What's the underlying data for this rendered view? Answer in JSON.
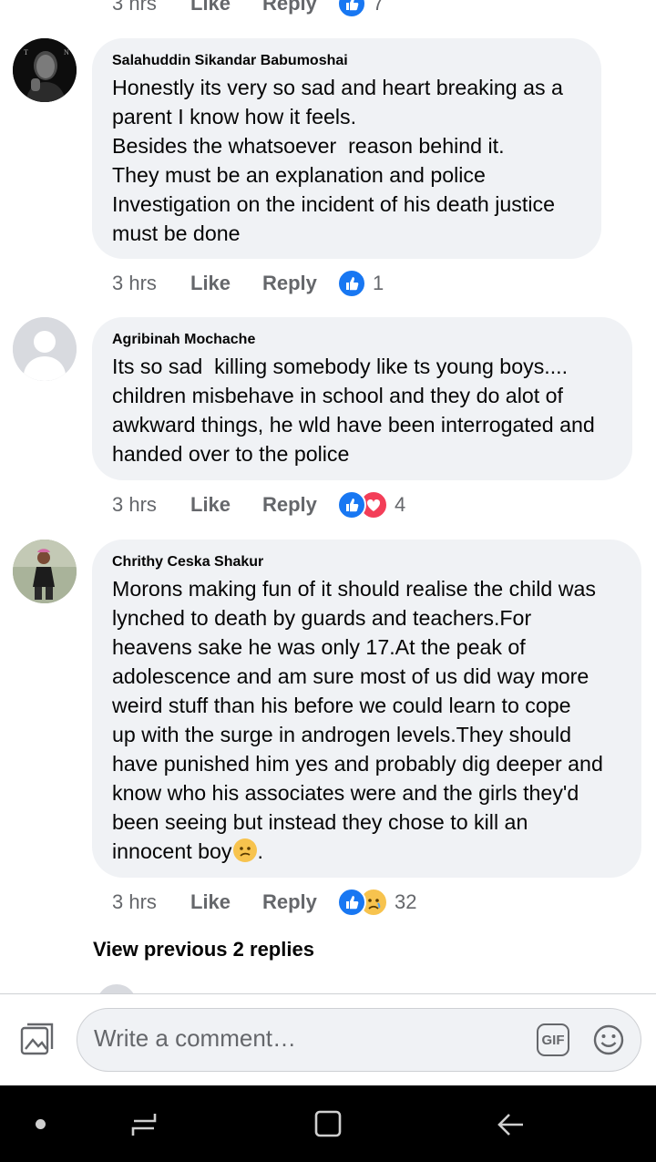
{
  "top_partial": {
    "time": "3 hrs",
    "like_label": "Like",
    "reply_label": "Reply",
    "reaction_count": "7"
  },
  "comments": [
    {
      "author": "Salahuddin Sikandar Babumoshai",
      "avatar": "person-photo-avatar",
      "text": "Honestly its very so sad and heart breaking as a\nparent I know how it feels.\nBesides the whatsoever  reason behind it.\nThey must be an explanation and police\nInvestigation on the incident of his death justice\nmust be done",
      "time": "3 hrs",
      "like_label": "Like",
      "reply_label": "Reply",
      "reactions": [
        "like"
      ],
      "reaction_count": "1"
    },
    {
      "author": "Agribinah Mochache",
      "avatar": "default-avatar",
      "text": "Its so sad  killing somebody like ts young boys....\nchildren misbehave in school and they do alot of\nawkward things, he wld have been interrogated and\nhanded over to the police",
      "time": "3 hrs",
      "like_label": "Like",
      "reply_label": "Reply",
      "reactions": [
        "like",
        "love"
      ],
      "reaction_count": "4"
    },
    {
      "author": "Chrithy Ceska Shakur",
      "avatar": "person-photo-avatar",
      "text": "Morons making fun of it should realise the child was\nlynched to death by guards and teachers.For\nheavens sake he was only 17.At the peak of\nadolescence and am sure most of us did way more\nweird stuff than his before we could learn to cope\nup with the surge in androgen levels.They should\nhave punished him yes and probably dig deeper and\nknow who his associates were and the girls they'd\nbeen seeing but instead they chose to kill an\ninnocent boy",
      "text_end": ".",
      "time": "3 hrs",
      "like_label": "Like",
      "reply_label": "Reply",
      "reactions": [
        "like",
        "sad"
      ],
      "reaction_count": "32"
    }
  ],
  "view_previous": "View previous 2 replies",
  "composer": {
    "placeholder": "Write a comment…",
    "gif_label": "GIF",
    "photo_icon": "photo-icon",
    "emoji_icon": "emoji-icon"
  },
  "colors": {
    "bubble_bg": "#f0f2f5",
    "like_blue": "#1877f2",
    "love_red": "#f33e58",
    "sad_yellow": "#f7c34e",
    "meta_gray": "#65676b"
  }
}
